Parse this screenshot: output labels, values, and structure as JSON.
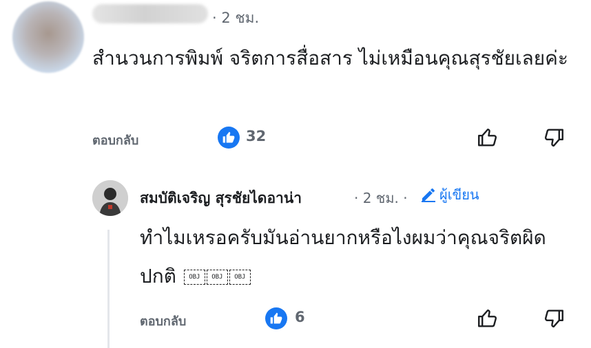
{
  "comment": {
    "time": "· 2 ชม.",
    "text": "สำนวนการพิมพ์ จริตการสื่อสาร ไม่เหมือนคุณสุรชัยเลยค่ะ",
    "reply_label": "ตอบกลับ",
    "like_count": "32",
    "icons": [
      "thumbs-up-like-badge-icon",
      "like-outline-icon",
      "dislike-outline-icon"
    ]
  },
  "reply": {
    "author": "สมบัติเจริญ สุรชัยไดอาน่า",
    "time": "· 2 ชม. ·",
    "author_badge": "ผู้เขียน",
    "text": "ทำไมเหรอครับมันอ่านยากหรือไงผมว่าคุณจริตผิดปกติ",
    "objects": [
      "OBJ",
      "OBJ",
      "OBJ"
    ],
    "reply_label": "ตอบกลับ",
    "like_count": "6"
  },
  "colors": {
    "accent": "#1877f2",
    "muted": "#606770",
    "text": "#1c1e21"
  }
}
